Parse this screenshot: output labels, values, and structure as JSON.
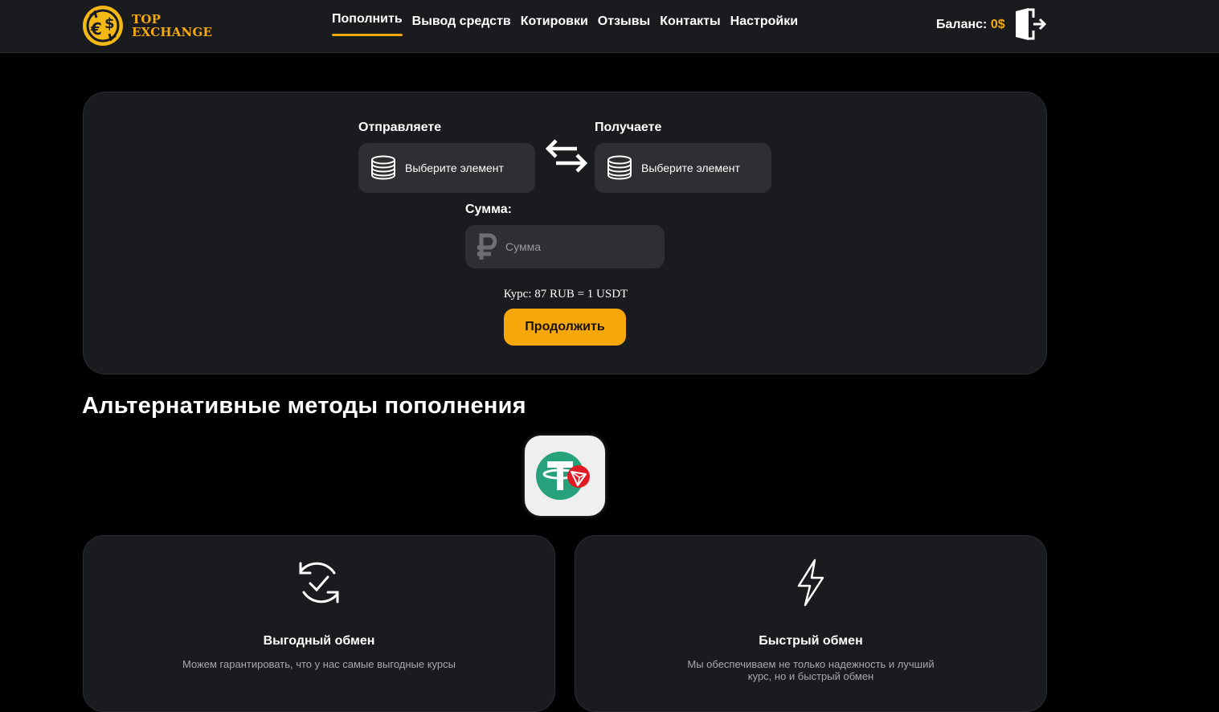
{
  "header": {
    "logo_line1": "TOP",
    "logo_line2": "EXCHANGE",
    "nav": [
      "Пополнить",
      "Вывод средств",
      "Котировки",
      "Отзывы",
      "Контакты",
      "Настройки"
    ],
    "active_nav": "Пополнить",
    "balance_label": "Баланс:",
    "balance_value": "0$"
  },
  "exchange": {
    "send_label": "Отправляете",
    "receive_label": "Получаете",
    "send_select": "Выберите элемент",
    "receive_select": "Выберите элемент",
    "sum_label": "Сумма:",
    "sum_placeholder": "Сумма",
    "rate_text": "Курс: 87 RUB = 1 USDT",
    "continue_label": "Продолжить"
  },
  "alternative": {
    "title": "Альтернативные методы пополнения",
    "methods": [
      "usdt-trc20-icon"
    ]
  },
  "features": [
    {
      "title": "Выгодный обмен",
      "description": "Можем гарантировать, что у нас самые выгодные курсы",
      "icon": "refresh-check-icon"
    },
    {
      "title": "Быстрый обмен",
      "description": "Мы обеспечиваем не только надежность и лучший курс, но и быстрый обмен",
      "icon": "lightning-icon"
    }
  ],
  "colors": {
    "accent": "#f4a90c",
    "card_bg": "#1a1b1f",
    "input_bg": "#2e2f33",
    "page_bg": "#000000"
  }
}
